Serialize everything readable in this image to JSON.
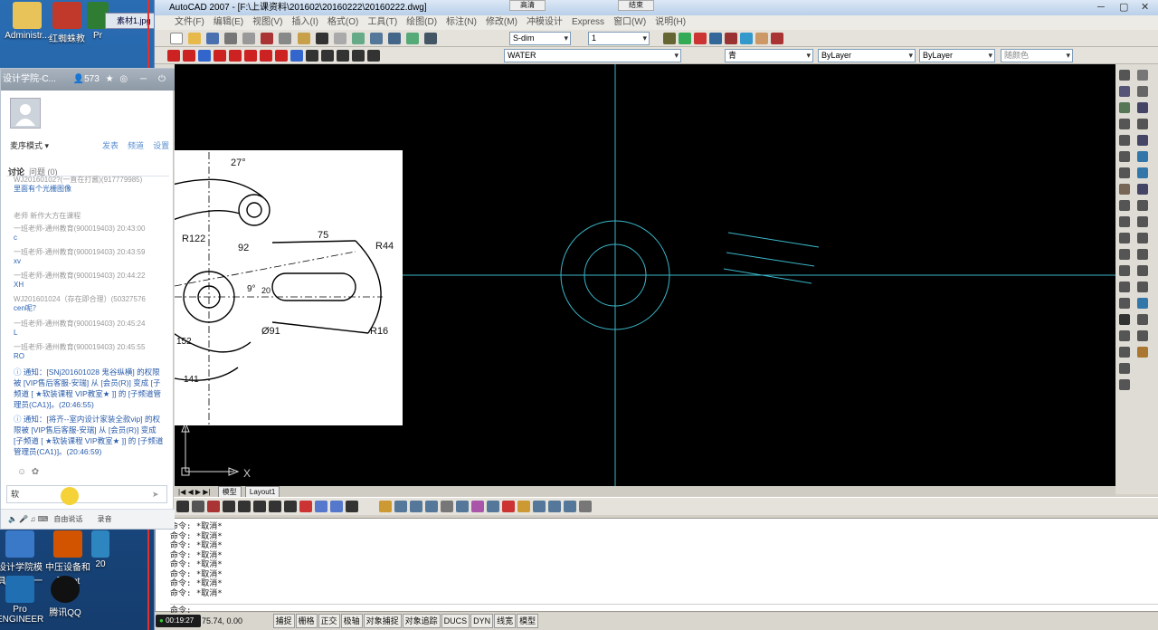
{
  "desktop": {
    "icons": [
      {
        "label": "Administr...",
        "icon": "user-folder-icon"
      },
      {
        "label": "红蜘蛛教",
        "icon": "spider-app-icon"
      },
      {
        "label": "Pr",
        "icon": "program-icon"
      },
      {
        "label": "素材1.jpg",
        "icon": "image-file-icon"
      },
      {
        "label": "设计学院模具设计第一阶…",
        "icon": "folder-icon"
      },
      {
        "label": "中压设备和元.ppt",
        "icon": "ppt-file-icon"
      },
      {
        "label": "20",
        "icon": "file-icon"
      },
      {
        "label": "Pro ENGINEER",
        "icon": "pro-engineer-icon"
      },
      {
        "label": "腾讯QQ",
        "icon": "qq-icon"
      }
    ],
    "top_buttons": [
      "高清",
      "结束"
    ]
  },
  "autocad": {
    "title": "AutoCAD 2007 - [F:\\上课资料\\201602\\20160222\\20160222.dwg]",
    "menu": [
      "文件(F)",
      "编辑(E)",
      "视图(V)",
      "插入(I)",
      "格式(O)",
      "工具(T)",
      "绘图(D)",
      "标注(N)",
      "修改(M)",
      "冲模设计",
      "Express",
      "窗口(W)",
      "说明(H)"
    ],
    "dim_style": "S-dim",
    "text_style": "1",
    "layer": "WATER",
    "color": "青",
    "linetype1": "ByLayer",
    "linetype2": "ByLayer",
    "plot_style": "随颜色",
    "tabs": [
      "模型",
      "Layout1"
    ],
    "command_history": [
      "命令: *取消*",
      "命令: *取消*",
      "命令: *取消*",
      "命令: *取消*",
      "命令: *取消*",
      "命令: *取消*",
      "命令: *取消*",
      "命令: *取消*"
    ],
    "command_prompt": "命令:",
    "coordinates": "75.74, 0.00",
    "status_buttons": [
      "捕捉",
      "栅格",
      "正交",
      "极轴",
      "对象捕捉",
      "对象追踪",
      "DUCS",
      "DYN",
      "线宽",
      "模型"
    ],
    "timer": "00:19:27",
    "ucs_x_label": "X",
    "ref_dims": [
      "27°",
      "R122",
      "92",
      "75",
      "R44",
      "9°",
      "20",
      "R16",
      "Ø91",
      "152",
      "141"
    ]
  },
  "chat": {
    "title": "设计学院-C...",
    "member_count": "573",
    "mode": "麦序模式",
    "header_links": [
      "发表",
      "频道",
      "设置"
    ],
    "tabs": [
      "讨论",
      "问题 (0)"
    ],
    "messages": [
      {
        "who": "WJ20160102?(一直在打酱)(917779985)",
        "text": "里面有个光栅图像"
      },
      {
        "who": "老师 新作大方在课程",
        "text": ""
      },
      {
        "who": "一班老师-通州教育(900019403) 20:43:00",
        "text": "c"
      },
      {
        "who": "一班老师-通州教育(900019403) 20:43:59",
        "text": "xv"
      },
      {
        "who": "一班老师-通州教育(900019403) 20:44:22",
        "text": "XH"
      },
      {
        "who": "WJ201601024（存在即合理）(50327576",
        "text": "cen呢？"
      },
      {
        "who": "一班老师-通州教育(900019403) 20:45:24",
        "text": "L"
      },
      {
        "who": "一班老师-通州教育(900019403) 20:45:55",
        "text": "RO"
      }
    ],
    "notices": [
      "通知：[SNj201601028 鬼谷纵横] 的权限被 [VIP售后客服-安瑞] 从 [会员(R)] 变成 [子频道 [     ★软装课程  VIP教室★    ]] 的 [子频道管理员(CA1)]。(20:46:55)",
      "通知：[将齐--室内设计家装全款vip] 的权限被 [VIP售后客服-安瑞] 从 [会员(R)] 变成 [子频道 [     ★软装课程  VIP教室★    ]] 的 [子频道管理员(CA1)]。(20:46:59)"
    ],
    "input_value": "软",
    "bottom_labels": [
      "自由说话",
      "录音"
    ]
  }
}
